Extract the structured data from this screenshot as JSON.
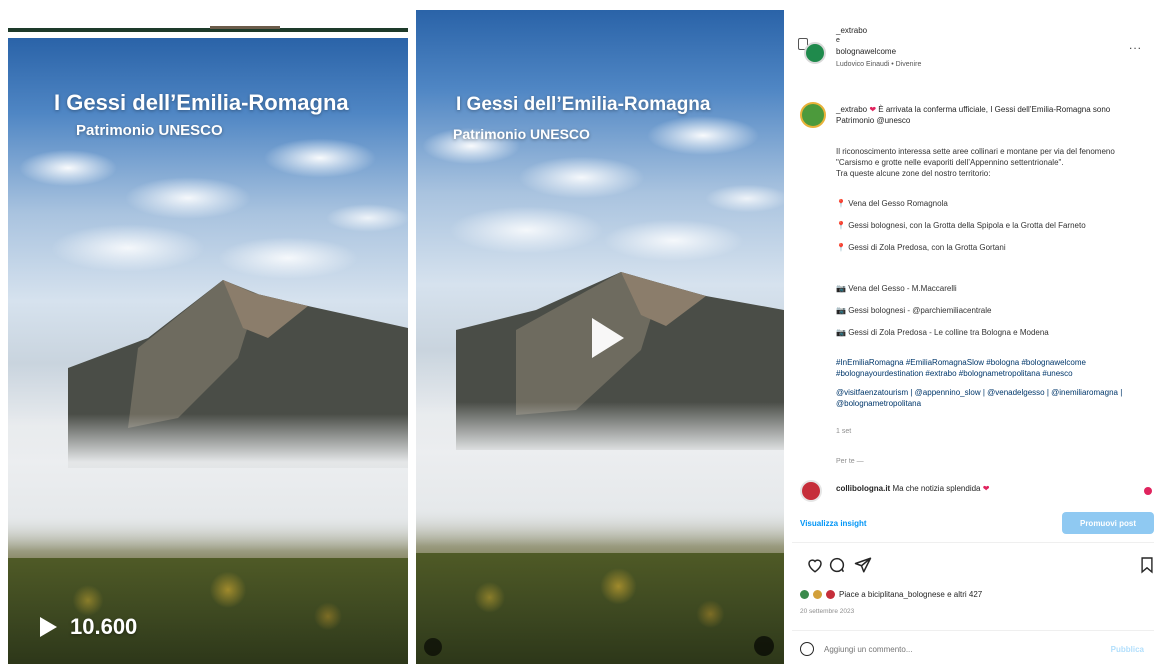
{
  "panel1": {
    "title": "I Gessi dell’Emilia-Romagna",
    "subtitle": "Patrimonio UNESCO",
    "views": "10.600",
    "views_icon": "play-icon"
  },
  "panel2": {
    "title": "I Gessi dell’Emilia-Romagna",
    "subtitle": "Patrimonio UNESCO",
    "play_icon": "play-icon"
  },
  "post": {
    "header": {
      "user1": "_extrabo",
      "separator": "e",
      "user2": "bolognawelcome",
      "audio": "Ludovico Einaudi • Divenire",
      "more": "..."
    },
    "caption": {
      "username": "_extrabo",
      "first_line": " È arrivata la conferma ufficiale, I Gessi dell’Emilia-Romagna sono Patrimonio @unesco",
      "paragraph1": "Il riconoscimento interessa sette aree collinari e montane per via del fenomeno \"Carsismo e grotte nelle evaporiti dell’Appennino settentrionale\".\nTra queste alcune zone del nostro territorio:",
      "list": [
        "Vena del Gesso Romagnola",
        "Gessi bolognesi, con la Grotta della Spipola e la Grotta del Farneto",
        "Gessi di Zola Predosa, con la Grotta Gortani"
      ],
      "credits": [
        "Vena del Gesso - M.Maccarelli",
        "Gessi bolognesi - @parchiemiliacentrale",
        "Gessi di Zola Predosa - Le colline tra Bologna e Modena"
      ],
      "hashtags": "#InEmiliaRomagna #EmiliaRomagnaSlow #bologna #bolognawelcome #bolognayourdestination #extrabo #bolognametropolitana #unesco",
      "mentions": "@visitfaenzatourism | @appennino_slow | @venadelgesso | @inemiliaromagna | @bolognametropolitana",
      "time": "1 set",
      "see_translation": "Per te —"
    },
    "comment": {
      "username": "collibologna.it",
      "text": "Ma che notizia splendida"
    },
    "insights": "Visualizza insight",
    "promote": "Promuovi post",
    "likes": "Piace a biciplitana_bolognese e altri 427",
    "date": "20 settembre 2023",
    "comment_placeholder": "Aggiungi un commento...",
    "publish": "Pubblica"
  },
  "colors": {
    "link": "#0095f6",
    "heart": "#e0245e",
    "brand_green": "#1f8a4c"
  }
}
